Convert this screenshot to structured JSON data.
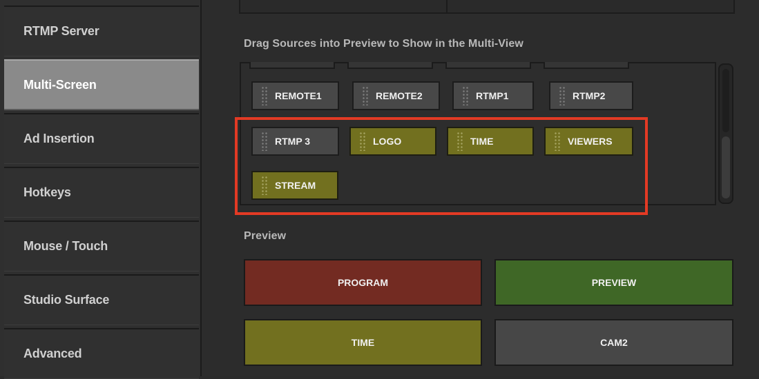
{
  "sidebar": {
    "items": [
      {
        "label": "RTMP Server",
        "active": false
      },
      {
        "label": "Multi-Screen",
        "active": true
      },
      {
        "label": "Ad Insertion",
        "active": false
      },
      {
        "label": "Hotkeys",
        "active": false
      },
      {
        "label": "Mouse / Touch",
        "active": false
      },
      {
        "label": "Studio Surface",
        "active": false
      },
      {
        "label": "Advanced",
        "active": false
      }
    ]
  },
  "main": {
    "sources_header": "Drag Sources into Preview to Show in the Multi-View",
    "sources": [
      {
        "label": "REMOTE1",
        "color": "gray"
      },
      {
        "label": "REMOTE2",
        "color": "gray"
      },
      {
        "label": "RTMP1",
        "color": "gray"
      },
      {
        "label": "RTMP2",
        "color": "gray"
      },
      {
        "label": "RTMP 3",
        "color": "gray"
      },
      {
        "label": "LOGO",
        "color": "olive"
      },
      {
        "label": "TIME",
        "color": "olive"
      },
      {
        "label": "VIEWERS",
        "color": "olive"
      },
      {
        "label": "STREAM",
        "color": "olive"
      }
    ],
    "preview_header": "Preview",
    "preview_tiles": [
      {
        "label": "PROGRAM",
        "color": "#732b22"
      },
      {
        "label": "PREVIEW",
        "color": "#3f6726"
      },
      {
        "label": "TIME",
        "color": "#72701f"
      },
      {
        "label": "CAM2",
        "color": "#474747"
      }
    ]
  },
  "colors": {
    "highlight": "#e33a24",
    "source_gray": "#484848",
    "source_olive": "#72701f",
    "sidebar_active": "#8a8a8a"
  }
}
